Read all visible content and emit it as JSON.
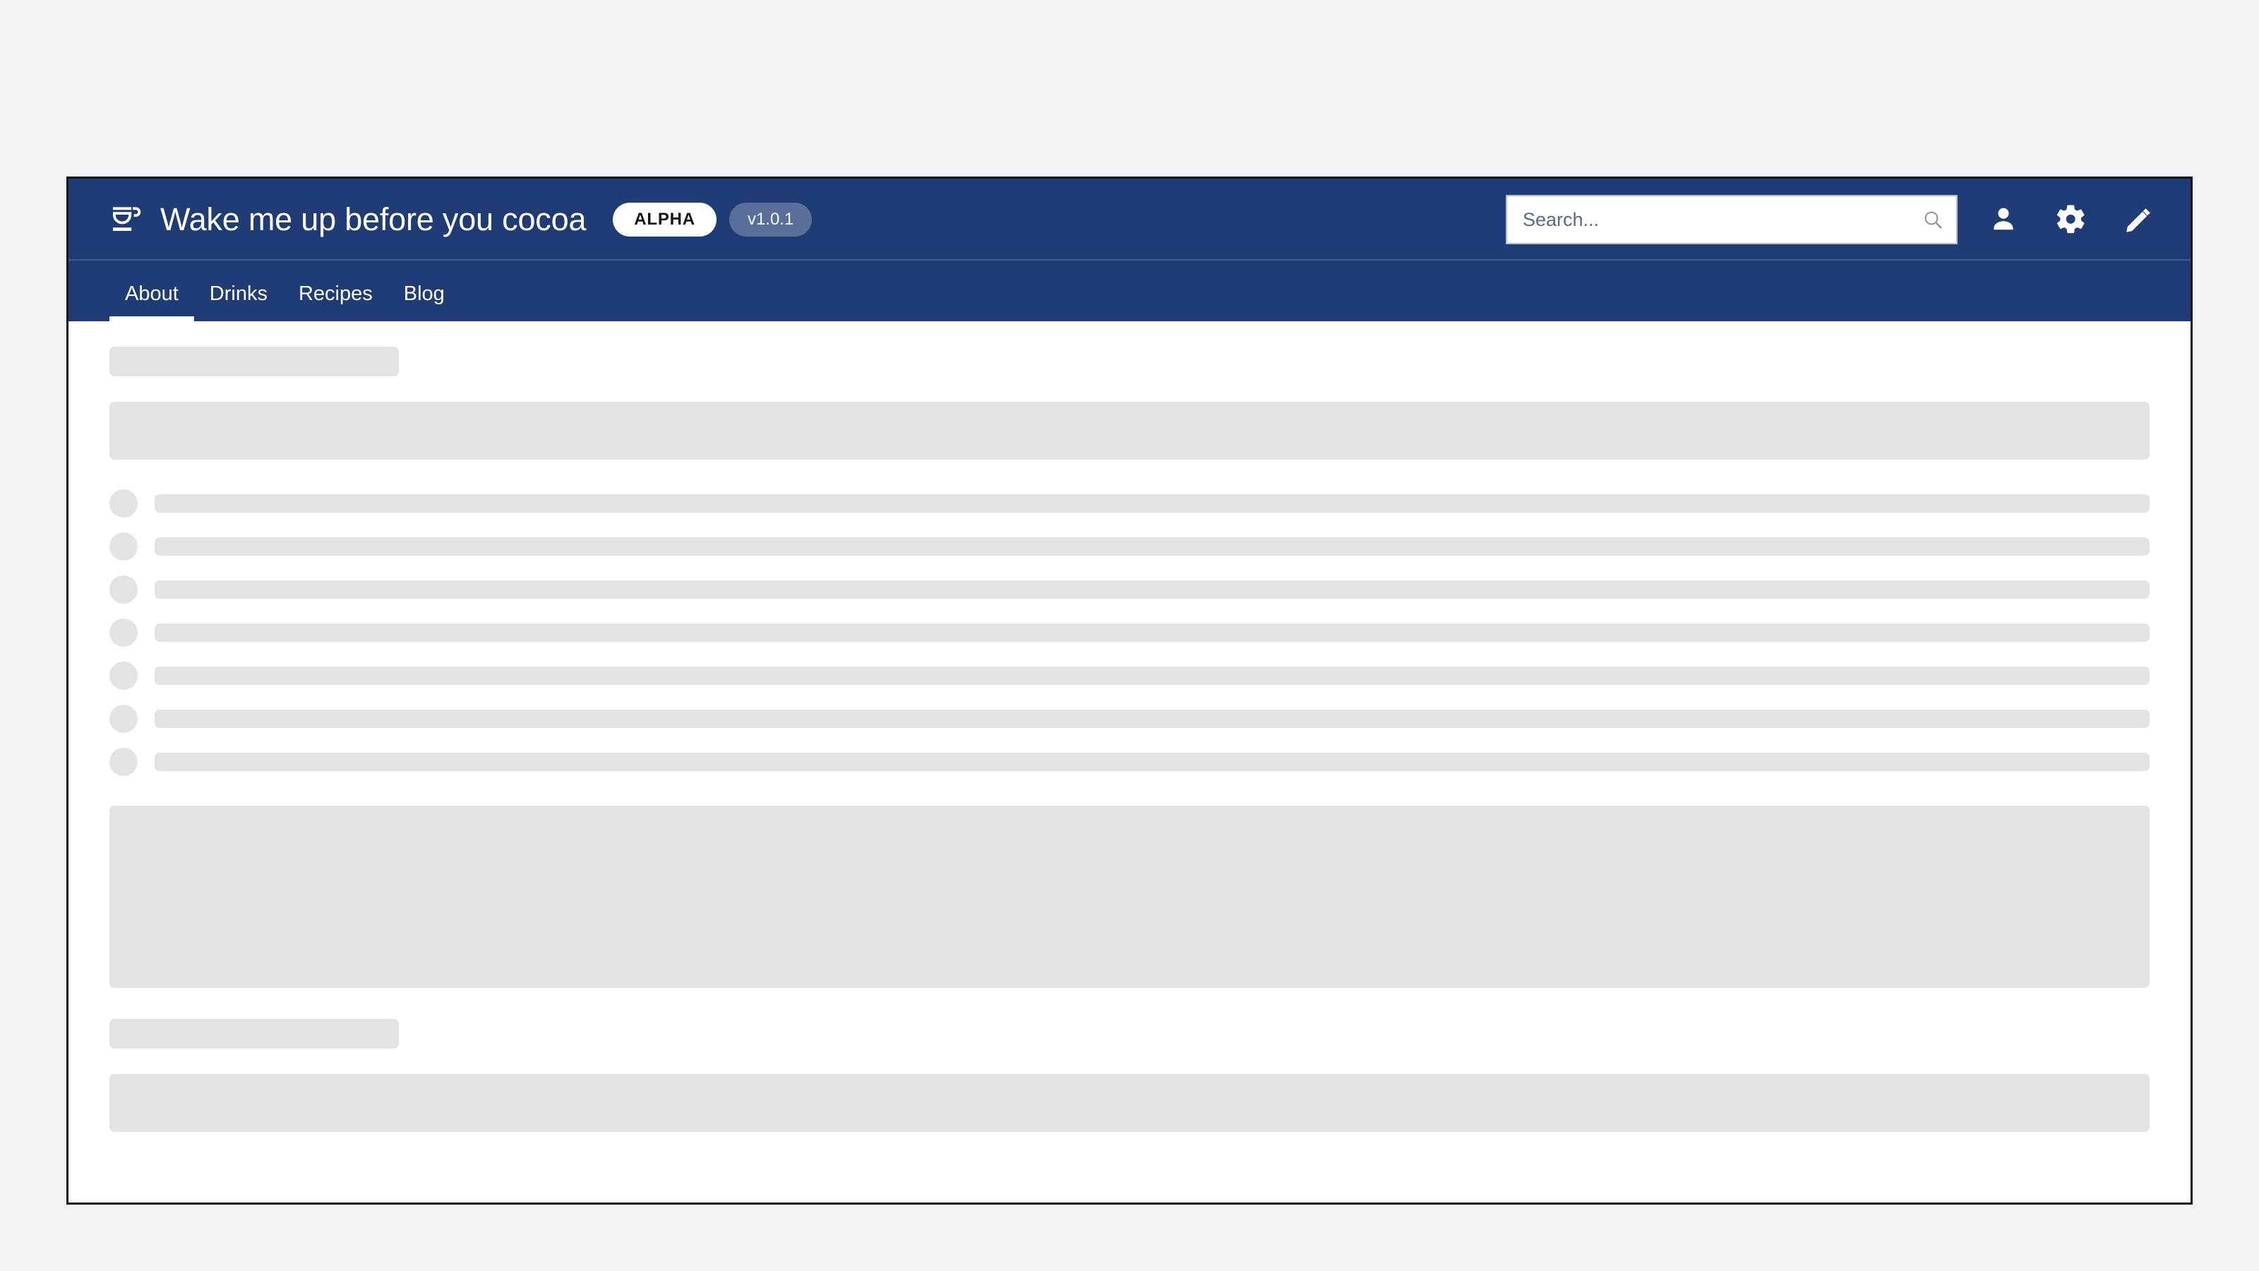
{
  "app": {
    "title": "Wake me up before you cocoa",
    "logo_icon": "coffee-cup-icon",
    "badges": {
      "stage": "ALPHA",
      "version": "v1.0.1"
    },
    "colors": {
      "header_background": "#1f3c76",
      "page_background": "#f3f3f3",
      "frame_border": "#111418",
      "content_background": "#ffffff",
      "skeleton": "#e1e3e5",
      "badge_alpha_background": "#ffffff",
      "badge_alpha_text": "#111418",
      "badge_version_background": "rgba(255,255,255,0.26)",
      "active_tab_indicator": "#ffffff"
    }
  },
  "search": {
    "placeholder": "Search...",
    "value": "",
    "icon": "search-icon"
  },
  "header_actions": [
    {
      "name": "account-icon",
      "label": "Account"
    },
    {
      "name": "gear-icon",
      "label": "Settings"
    },
    {
      "name": "pencil-icon",
      "label": "Edit"
    }
  ],
  "nav": {
    "active": "About",
    "tabs": [
      {
        "label": "About",
        "active": true
      },
      {
        "label": "Drinks",
        "active": false
      },
      {
        "label": "Recipes",
        "active": false
      },
      {
        "label": "Blog",
        "active": false
      }
    ]
  },
  "content": {
    "state": "loading-skeleton",
    "skeleton": {
      "title_placeholder": "",
      "hero_placeholder": "",
      "row_count": 7,
      "block_placeholder": "",
      "subtitle_placeholder": "",
      "footer_placeholder": ""
    }
  }
}
